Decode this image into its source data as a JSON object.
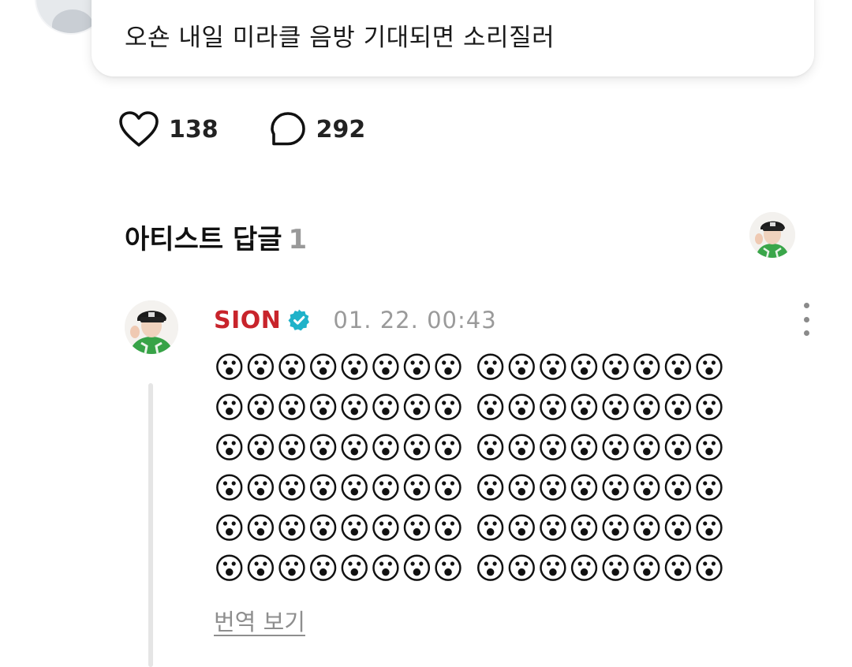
{
  "post": {
    "text": "오숀 내일 미라클 음방 기대되면 소리질러"
  },
  "reactions": {
    "like_count": "138",
    "comment_count": "292"
  },
  "artist_replies": {
    "title": "아티스트 답글",
    "count": "1"
  },
  "comment": {
    "author": "SION",
    "timestamp": "01. 22. 00:43",
    "emoji_lines": [
      {
        "left": "😮😮😮😮😮😮😮😮",
        "right": "😮😮😮😮😮😮😮😮"
      },
      {
        "left": "😮😮😮😮😮😮😮😮",
        "right": "😮😮😮😮😮😮😮😮"
      },
      {
        "left": "😮😮😮😮😮😮😮😮",
        "right": "😮😮😮😮😮😮😮😮"
      },
      {
        "left": "😮😮😮😮😮😮😮😮",
        "right": "😮😮😮😮😮😮😮😮"
      },
      {
        "left": "😮😮😮😮😮😮😮😮",
        "right": "😮😮😮😮😮😮😮😮"
      },
      {
        "left": "😮😮😮😮😮😮😮😮",
        "right": "😮😮😮😮😮😮😮😮"
      }
    ],
    "translate_label": "번역 보기"
  },
  "icons": {
    "like": "heart-icon",
    "comment": "comment-bubble-icon",
    "verified": "verified-badge-icon",
    "more": "more-vertical-icon"
  },
  "colors": {
    "author_name": "#c8242b",
    "verified_badge": "#1fb2c9",
    "timestamp": "#9a9a9a",
    "count_muted": "#999999"
  }
}
